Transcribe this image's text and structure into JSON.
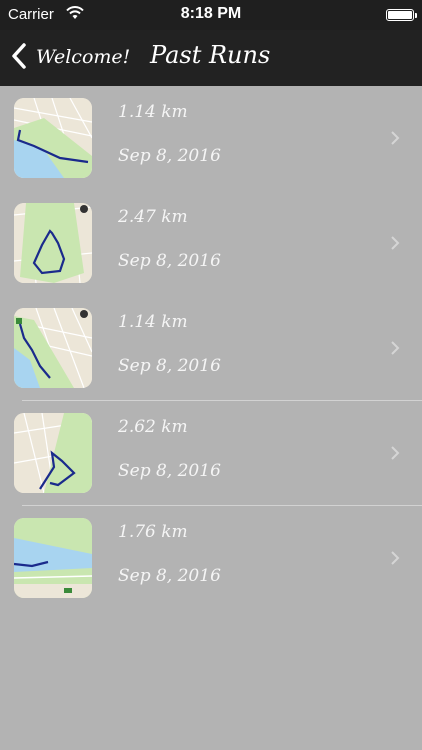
{
  "status_bar": {
    "carrier": "Carrier",
    "time": "8:18 PM"
  },
  "nav": {
    "back_label": "Welcome!",
    "title": "Past Runs"
  },
  "runs": [
    {
      "distance": "1.14 km",
      "date": "Sep 8, 2016"
    },
    {
      "distance": "2.47 km",
      "date": "Sep 8, 2016"
    },
    {
      "distance": "1.14 km",
      "date": "Sep 8, 2016"
    },
    {
      "distance": "2.62 km",
      "date": "Sep 8, 2016"
    },
    {
      "distance": "1.76 km",
      "date": "Sep 8, 2016"
    }
  ],
  "colors": {
    "background": "#b3b3b3",
    "bar": "#222222",
    "text": "#f5f5f5",
    "route": "#1a2a8c",
    "park": "#c9e6b0",
    "water": "#a8d4f0"
  }
}
